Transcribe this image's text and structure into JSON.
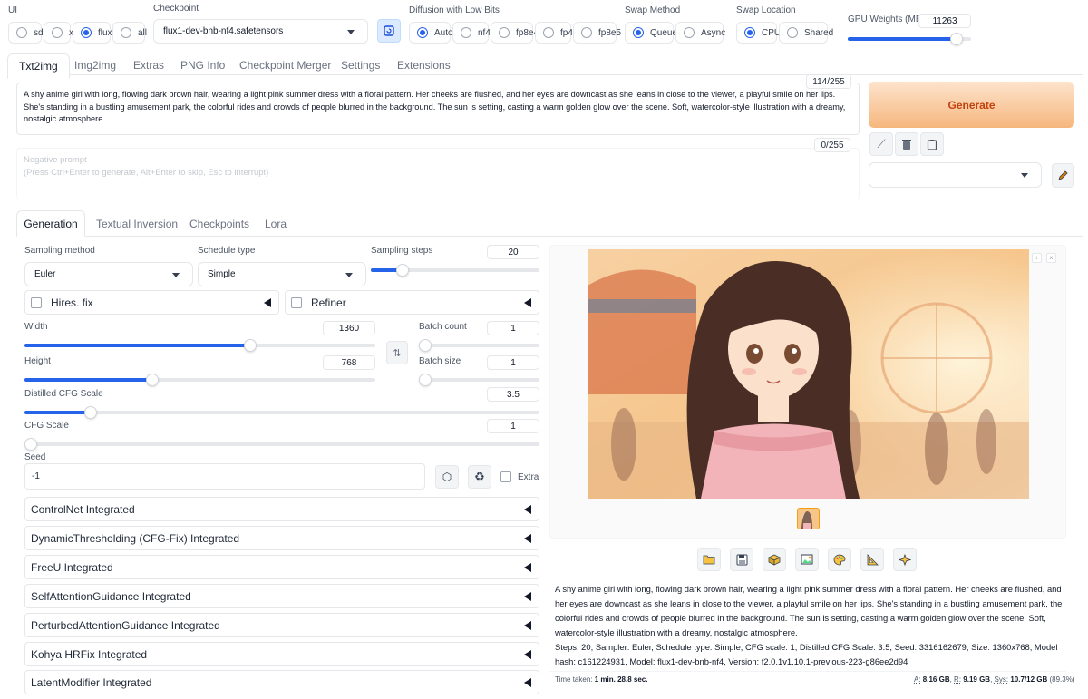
{
  "ui_selector": {
    "label": "UI",
    "options": [
      "sd",
      "xl",
      "flux",
      "all"
    ],
    "selected": "flux"
  },
  "checkpoint": {
    "label": "Checkpoint",
    "value": "flux1-dev-bnb-nf4.safetensors"
  },
  "diffusion_low_bits": {
    "label": "Diffusion with Low Bits",
    "options": [
      "Auto",
      "nf4",
      "fp8e4",
      "fp4",
      "fp8e5"
    ],
    "selected": "Auto"
  },
  "swap_method": {
    "label": "Swap Method",
    "options": [
      "Queue",
      "Async"
    ],
    "selected": "Queue"
  },
  "swap_location": {
    "label": "Swap Location",
    "options": [
      "CPU",
      "Shared"
    ],
    "selected": "CPU"
  },
  "gpu_weights": {
    "label": "GPU Weights (MB)",
    "value": "11263",
    "level": 0.93
  },
  "main_tabs": [
    "Txt2img",
    "Img2img",
    "Extras",
    "PNG Info",
    "Checkpoint Merger",
    "Settings",
    "Extensions"
  ],
  "prompt": {
    "text": "A shy anime girl with long, flowing dark brown hair, wearing a light pink summer dress with a floral pattern. Her cheeks are flushed, and her eyes are downcast as she leans in close to the viewer, a playful smile on her lips. She's standing in a bustling amusement park, the colorful rides and crowds of people blurred in the background. The sun is setting, casting a warm golden glow over the scene. Soft, watercolor-style illustration with a dreamy, nostalgic atmosphere.",
    "token_count": "114/255"
  },
  "negative_prompt": {
    "placeholder_title": "Negative prompt",
    "placeholder_hint": "(Press Ctrl+Enter to generate, Alt+Enter to skip, Esc to interrupt)",
    "token_count": "0/255"
  },
  "generate_label": "Generate",
  "sub_tabs": [
    "Generation",
    "Textual Inversion",
    "Checkpoints",
    "Lora"
  ],
  "sampling_method": {
    "label": "Sampling method",
    "value": "Euler"
  },
  "schedule_type": {
    "label": "Schedule type",
    "value": "Simple"
  },
  "sampling_steps": {
    "label": "Sampling steps",
    "value": "20",
    "level": 0.16
  },
  "hires_fix": {
    "label": "Hires. fix"
  },
  "refiner": {
    "label": "Refiner"
  },
  "width": {
    "label": "Width",
    "value": "1360",
    "level": 0.65
  },
  "height": {
    "label": "Height",
    "value": "768",
    "level": 0.36
  },
  "batch_count": {
    "label": "Batch count",
    "value": "1",
    "level": 0.0
  },
  "batch_size": {
    "label": "Batch size",
    "value": "1",
    "level": 0.0
  },
  "distilled_cfg": {
    "label": "Distilled CFG Scale",
    "value": "3.5",
    "level": 0.12
  },
  "cfg_scale": {
    "label": "CFG Scale",
    "value": "1",
    "level": 0.0
  },
  "seed": {
    "label": "Seed",
    "value": "-1",
    "extra_label": "Extra"
  },
  "accordions": [
    "ControlNet Integrated",
    "DynamicThresholding (CFG-Fix) Integrated",
    "FreeU Integrated",
    "SelfAttentionGuidance Integrated",
    "PerturbedAttentionGuidance Integrated",
    "Kohya HRFix Integrated",
    "LatentModifier Integrated"
  ],
  "output": {
    "info_prompt": "A shy anime girl with long, flowing dark brown hair, wearing a light pink summer dress with a floral pattern. Her cheeks are flushed, and her eyes are downcast as she leans in close to the viewer, a playful smile on her lips. She's standing in a bustling amusement park, the colorful rides and crowds of people blurred in the background. The sun is setting, casting a warm golden glow over the scene. Soft, watercolor-style illustration with a dreamy, nostalgic atmosphere.",
    "info_params": "Steps: 20, Sampler: Euler, Schedule type: Simple, CFG scale: 1, Distilled CFG Scale: 3.5, Seed: 3316162679, Size: 1360x768, Model hash: c161224931, Model: flux1-dev-bnb-nf4, Version: f2.0.1v1.10.1-previous-223-g86ee2d94",
    "time_label": "Time taken:",
    "time_value": "1 min. 28.8 sec.",
    "mem_a_label": "A:",
    "mem_a_value": "8.16 GB",
    "mem_r_label": "R:",
    "mem_r_value": "9.19 GB",
    "mem_sys_label": "Sys:",
    "mem_sys_value": "10.7/12 GB",
    "mem_pct": "(89.3%)"
  },
  "colors": {
    "accent": "#2563eb",
    "generate_from": "#fde3cc",
    "generate_to": "#f6b77e",
    "generate_text": "#c2410c"
  }
}
